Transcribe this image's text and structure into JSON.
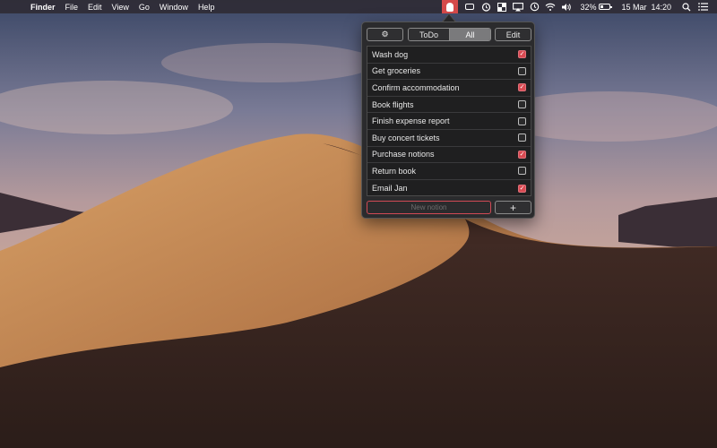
{
  "menubar": {
    "apple_glyph": "",
    "app_name": "Finder",
    "menus": [
      "File",
      "Edit",
      "View",
      "Go",
      "Window",
      "Help"
    ],
    "battery_percent": "32%",
    "date": "15 Mar",
    "time": "14:20"
  },
  "popover": {
    "gear_glyph": "⚙",
    "segments": [
      "ToDo",
      "All"
    ],
    "active_segment": "All",
    "edit_label": "Edit",
    "items": [
      {
        "label": "Wash dog",
        "checked": true
      },
      {
        "label": "Get groceries",
        "checked": false
      },
      {
        "label": "Confirm accommodation",
        "checked": true
      },
      {
        "label": "Book flights",
        "checked": false
      },
      {
        "label": "Finish expense report",
        "checked": false
      },
      {
        "label": "Buy concert tickets",
        "checked": false
      },
      {
        "label": "Purchase notions",
        "checked": true
      },
      {
        "label": "Return book",
        "checked": false
      },
      {
        "label": "Email Jan",
        "checked": true
      }
    ],
    "new_placeholder": "New notion",
    "add_glyph": "+"
  },
  "colors": {
    "accent": "#d94a52",
    "popover_bg": "#2b2b2d",
    "list_bg": "#1f1f20"
  },
  "icons": [
    "app-bulb-icon",
    "screen-icon",
    "alarm-icon",
    "grid-icon",
    "airplay-icon",
    "time-machine-icon",
    "wifi-icon",
    "volume-icon",
    "battery-icon",
    "search-icon",
    "notification-list-icon"
  ]
}
